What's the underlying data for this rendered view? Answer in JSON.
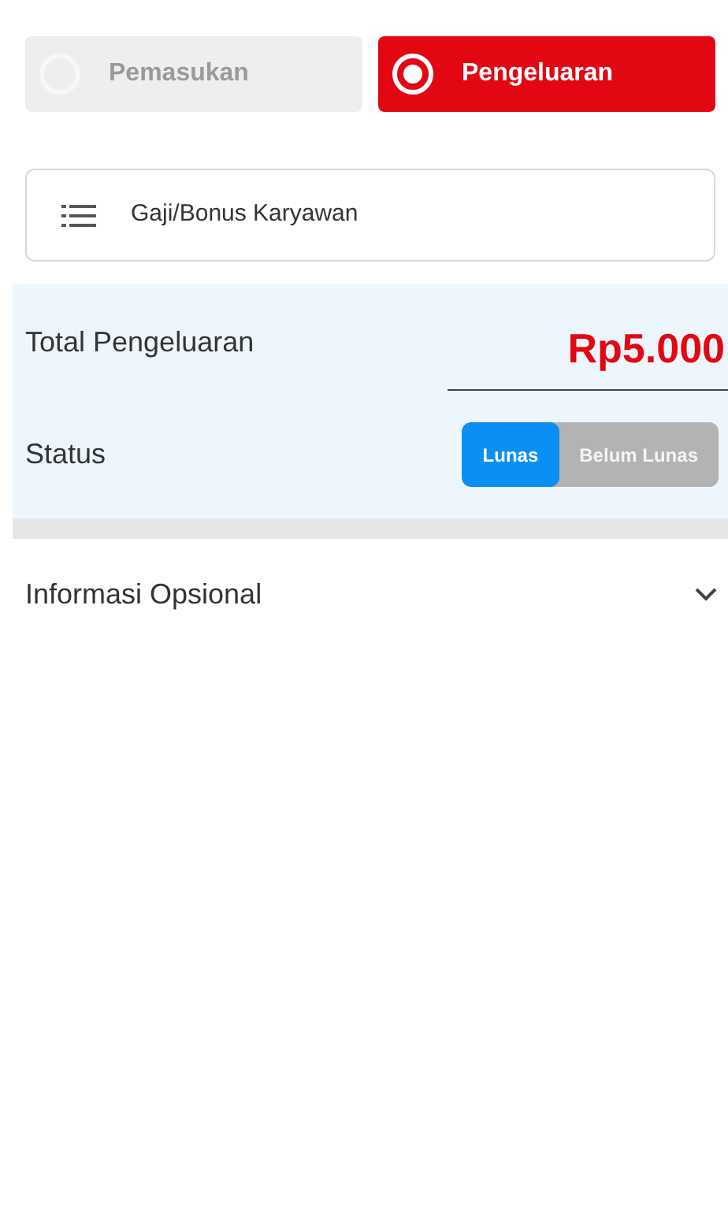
{
  "type_options": [
    {
      "label": "Pemasukan",
      "selected": false
    },
    {
      "label": "Pengeluaran",
      "selected": true
    }
  ],
  "category": {
    "value": "Gaji/Bonus Karyawan"
  },
  "total": {
    "label": "Total Pengeluaran",
    "value": "Rp5.000"
  },
  "status": {
    "label": "Status",
    "options": [
      {
        "label": "Lunas",
        "selected": true
      },
      {
        "label": "Belum Lunas",
        "selected": false
      }
    ]
  },
  "optional_section": {
    "title": "Informasi Opsional",
    "expanded": false
  }
}
